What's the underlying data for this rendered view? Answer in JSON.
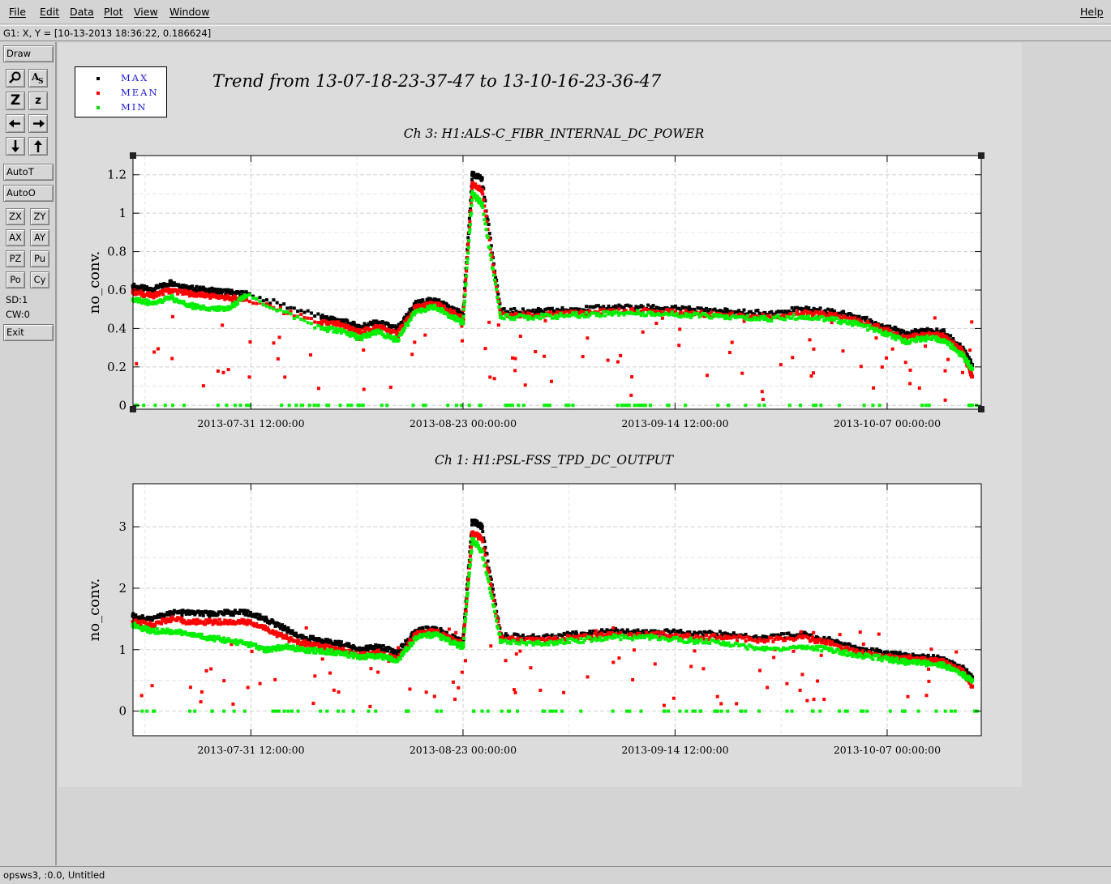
{
  "menu": {
    "file": "File",
    "edit": "Edit",
    "data": "Data",
    "plot": "Plot",
    "view": "View",
    "window": "Window",
    "help": "Help"
  },
  "coord_readout": "G1: X, Y = [10-13-2013 18:36:22, 0.186624]",
  "toolbar": {
    "draw": "Draw",
    "zoom_icon_glyph": "🔍",
    "text_icon_glyph": "A",
    "zoom_z_big": "Z",
    "zoom_z_small": "z",
    "left_arrow": "←",
    "right_arrow": "→",
    "down_arrow": "↓",
    "up_arrow": "↑",
    "autot": "AutoT",
    "autoo": "AutoO",
    "zx": "ZX",
    "zy": "ZY",
    "ax": "AX",
    "ay": "AY",
    "pz": "PZ",
    "pu": "Pu",
    "po": "Po",
    "cy": "Cy",
    "sd": "SD:1",
    "cw": "CW:0",
    "exit": "Exit"
  },
  "legend": {
    "items": [
      {
        "label": "MAX",
        "color": "#000000"
      },
      {
        "label": "MEAN",
        "color": "#ff0000"
      },
      {
        "label": "MIN",
        "color": "#00dd00"
      }
    ]
  },
  "main_title": "Trend from 13-07-18-23-37-47 to 13-10-16-23-36-47",
  "status": "opsws3, :0.0, Untitled",
  "colors": {
    "max": "#000000",
    "mean": "#ff0000",
    "min": "#00ee00"
  },
  "chart_data": [
    {
      "type": "scatter",
      "title": "Ch 3: H1:ALS-C_FIBR_INTERNAL_DC_POWER",
      "ylabel": "no_conv.",
      "xlabel": "",
      "xlim": [
        "2013-07-18 23:37:47",
        "2013-10-16 23:36:47"
      ],
      "ylim": [
        -0.02,
        1.3
      ],
      "yticks": [
        0,
        0.2,
        0.4,
        0.6,
        0.8,
        1,
        1.2
      ],
      "xticks": [
        "2013-07-31 12:00:00",
        "2013-08-23 00:00:00",
        "2013-09-14 12:00:00",
        "2013-10-07 00:00:00"
      ],
      "grid": true,
      "series": [
        {
          "name": "MAX",
          "x": [
            "2013-07-19",
            "2013-07-21",
            "2013-07-23",
            "2013-07-25",
            "2013-07-27",
            "2013-07-29",
            "2013-07-31",
            "2013-08-08",
            "2013-08-10",
            "2013-08-12",
            "2013-08-14",
            "2013-08-16",
            "2013-08-18",
            "2013-08-20",
            "2013-08-22",
            "2013-08-23",
            "2013-08-24",
            "2013-08-25",
            "2013-08-27",
            "2013-08-31",
            "2013-09-04",
            "2013-09-08",
            "2013-09-12",
            "2013-09-16",
            "2013-09-20",
            "2013-09-24",
            "2013-09-28",
            "2013-10-01",
            "2013-10-04",
            "2013-10-07",
            "2013-10-09",
            "2013-10-11",
            "2013-10-13",
            "2013-10-15",
            "2013-10-16"
          ],
          "y": [
            0.62,
            0.6,
            0.64,
            0.61,
            0.6,
            0.59,
            0.58,
            0.46,
            0.44,
            0.41,
            0.43,
            0.4,
            0.53,
            0.55,
            0.5,
            0.47,
            1.2,
            1.18,
            0.49,
            0.49,
            0.5,
            0.51,
            0.51,
            0.5,
            0.49,
            0.48,
            0.5,
            0.49,
            0.46,
            0.41,
            0.37,
            0.39,
            0.38,
            0.3,
            0.21
          ]
        },
        {
          "name": "MEAN",
          "x": [
            "2013-07-19",
            "2013-07-21",
            "2013-07-23",
            "2013-07-25",
            "2013-07-27",
            "2013-07-29",
            "2013-07-31",
            "2013-08-08",
            "2013-08-10",
            "2013-08-12",
            "2013-08-14",
            "2013-08-16",
            "2013-08-18",
            "2013-08-20",
            "2013-08-22",
            "2013-08-23",
            "2013-08-24",
            "2013-08-25",
            "2013-08-27",
            "2013-08-31",
            "2013-09-04",
            "2013-09-08",
            "2013-09-12",
            "2013-09-16",
            "2013-09-20",
            "2013-09-24",
            "2013-09-28",
            "2013-10-01",
            "2013-10-04",
            "2013-10-07",
            "2013-10-09",
            "2013-10-11",
            "2013-10-13",
            "2013-10-15",
            "2013-10-16"
          ],
          "y": [
            0.59,
            0.57,
            0.6,
            0.58,
            0.57,
            0.56,
            0.55,
            0.43,
            0.42,
            0.38,
            0.41,
            0.37,
            0.51,
            0.53,
            0.48,
            0.45,
            1.15,
            1.12,
            0.47,
            0.47,
            0.48,
            0.49,
            0.49,
            0.48,
            0.47,
            0.46,
            0.48,
            0.47,
            0.44,
            0.39,
            0.35,
            0.37,
            0.36,
            0.28,
            0.15
          ]
        },
        {
          "name": "MIN",
          "x": [
            "2013-07-19",
            "2013-07-21",
            "2013-07-23",
            "2013-07-25",
            "2013-07-27",
            "2013-07-29",
            "2013-07-31",
            "2013-08-08",
            "2013-08-10",
            "2013-08-12",
            "2013-08-14",
            "2013-08-16",
            "2013-08-18",
            "2013-08-20",
            "2013-08-22",
            "2013-08-23",
            "2013-08-24",
            "2013-08-25",
            "2013-08-27",
            "2013-08-31",
            "2013-09-04",
            "2013-09-08",
            "2013-09-12",
            "2013-09-16",
            "2013-09-20",
            "2013-09-24",
            "2013-09-28",
            "2013-10-01",
            "2013-10-04",
            "2013-10-07",
            "2013-10-09",
            "2013-10-11",
            "2013-10-13",
            "2013-10-15",
            "2013-10-16"
          ],
          "y": [
            0.55,
            0.53,
            0.56,
            0.52,
            0.5,
            0.5,
            0.57,
            0.4,
            0.39,
            0.35,
            0.38,
            0.34,
            0.49,
            0.51,
            0.46,
            0.43,
            1.1,
            1.05,
            0.46,
            0.46,
            0.47,
            0.48,
            0.48,
            0.47,
            0.46,
            0.45,
            0.46,
            0.45,
            0.42,
            0.37,
            0.33,
            0.35,
            0.34,
            0.26,
            0.19
          ]
        }
      ]
    },
    {
      "type": "scatter",
      "title": "Ch 1: H1:PSL-FSS_TPD_DC_OUTPUT",
      "ylabel": "no_conv.",
      "xlabel": "",
      "xlim": [
        "2013-07-18 23:37:47",
        "2013-10-16 23:36:47"
      ],
      "ylim": [
        -0.4,
        3.7
      ],
      "yticks": [
        0,
        1,
        2,
        3
      ],
      "xticks": [
        "2013-07-31 12:00:00",
        "2013-08-23 00:00:00",
        "2013-09-14 12:00:00",
        "2013-10-07 00:00:00"
      ],
      "grid": true,
      "series": [
        {
          "name": "MAX",
          "x": [
            "2013-07-19",
            "2013-07-21",
            "2013-07-23",
            "2013-07-25",
            "2013-07-27",
            "2013-07-29",
            "2013-07-31",
            "2013-08-02",
            "2013-08-04",
            "2013-08-06",
            "2013-08-08",
            "2013-08-10",
            "2013-08-12",
            "2013-08-14",
            "2013-08-16",
            "2013-08-18",
            "2013-08-20",
            "2013-08-22",
            "2013-08-23",
            "2013-08-24",
            "2013-08-25",
            "2013-08-27",
            "2013-08-31",
            "2013-09-04",
            "2013-09-08",
            "2013-09-12",
            "2013-09-16",
            "2013-09-20",
            "2013-09-24",
            "2013-09-28",
            "2013-10-01",
            "2013-10-04",
            "2013-10-07",
            "2013-10-09",
            "2013-10-11",
            "2013-10-13",
            "2013-10-15",
            "2013-10-16"
          ],
          "y": [
            1.55,
            1.5,
            1.6,
            1.6,
            1.58,
            1.6,
            1.6,
            1.5,
            1.35,
            1.2,
            1.15,
            1.1,
            1.0,
            1.05,
            0.95,
            1.3,
            1.35,
            1.2,
            1.15,
            3.1,
            3.0,
            1.25,
            1.2,
            1.25,
            1.3,
            1.3,
            1.28,
            1.25,
            1.2,
            1.25,
            1.15,
            1.0,
            0.95,
            0.9,
            0.88,
            0.85,
            0.7,
            0.55
          ]
        },
        {
          "name": "MEAN",
          "x": [
            "2013-07-19",
            "2013-07-21",
            "2013-07-23",
            "2013-07-25",
            "2013-07-27",
            "2013-07-29",
            "2013-07-31",
            "2013-08-02",
            "2013-08-04",
            "2013-08-06",
            "2013-08-08",
            "2013-08-10",
            "2013-08-12",
            "2013-08-14",
            "2013-08-16",
            "2013-08-18",
            "2013-08-20",
            "2013-08-22",
            "2013-08-23",
            "2013-08-24",
            "2013-08-25",
            "2013-08-27",
            "2013-08-31",
            "2013-09-04",
            "2013-09-08",
            "2013-09-12",
            "2013-09-16",
            "2013-09-20",
            "2013-09-24",
            "2013-09-28",
            "2013-10-01",
            "2013-10-04",
            "2013-10-07",
            "2013-10-09",
            "2013-10-11",
            "2013-10-13",
            "2013-10-15",
            "2013-10-16"
          ],
          "y": [
            1.45,
            1.4,
            1.5,
            1.45,
            1.45,
            1.45,
            1.45,
            1.35,
            1.2,
            1.1,
            1.05,
            1.0,
            0.9,
            0.95,
            0.85,
            1.25,
            1.3,
            1.15,
            1.1,
            2.9,
            2.8,
            1.2,
            1.15,
            1.2,
            1.25,
            1.25,
            1.22,
            1.2,
            1.15,
            1.2,
            1.1,
            0.95,
            0.9,
            0.85,
            0.83,
            0.8,
            0.65,
            0.4
          ]
        },
        {
          "name": "MIN",
          "x": [
            "2013-07-19",
            "2013-07-21",
            "2013-07-23",
            "2013-07-25",
            "2013-07-27",
            "2013-07-29",
            "2013-07-31",
            "2013-08-02",
            "2013-08-04",
            "2013-08-06",
            "2013-08-08",
            "2013-08-10",
            "2013-08-12",
            "2013-08-14",
            "2013-08-16",
            "2013-08-18",
            "2013-08-20",
            "2013-08-22",
            "2013-08-23",
            "2013-08-24",
            "2013-08-25",
            "2013-08-27",
            "2013-08-31",
            "2013-09-04",
            "2013-09-08",
            "2013-09-12",
            "2013-09-16",
            "2013-09-20",
            "2013-09-24",
            "2013-09-28",
            "2013-10-01",
            "2013-10-04",
            "2013-10-07",
            "2013-10-09",
            "2013-10-11",
            "2013-10-13",
            "2013-10-15",
            "2013-10-16"
          ],
          "y": [
            1.4,
            1.3,
            1.3,
            1.25,
            1.2,
            1.15,
            1.1,
            1.0,
            1.05,
            1.0,
            0.98,
            0.95,
            0.88,
            0.9,
            0.82,
            1.2,
            1.25,
            1.1,
            1.05,
            2.8,
            2.6,
            1.15,
            1.1,
            1.15,
            1.2,
            1.2,
            1.15,
            1.1,
            1.0,
            1.05,
            1.0,
            0.9,
            0.85,
            0.8,
            0.78,
            0.75,
            0.6,
            0.5
          ]
        }
      ]
    }
  ]
}
